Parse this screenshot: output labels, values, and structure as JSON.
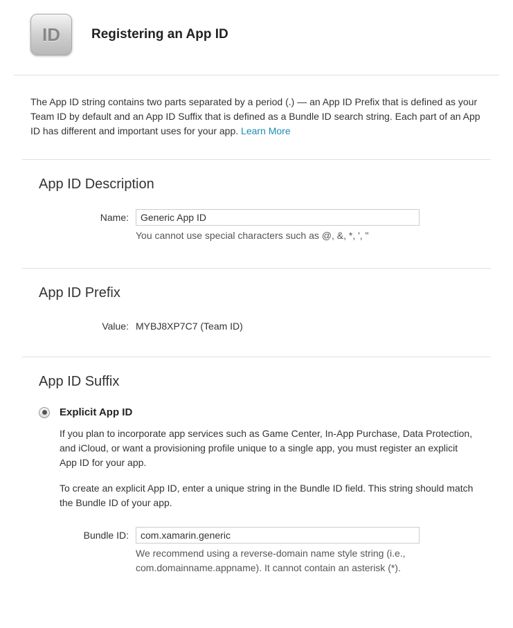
{
  "header": {
    "icon_text": "ID",
    "title": "Registering an App ID"
  },
  "intro": {
    "text": "The App ID string contains two parts separated by a period (.) — an App ID Prefix that is defined as your Team ID by default and an App ID Suffix that is defined as a Bundle ID search string. Each part of an App ID has different and important uses for your app. ",
    "learn_more": "Learn More"
  },
  "description_section": {
    "heading": "App ID Description",
    "name_label": "Name:",
    "name_value": "Generic App ID",
    "name_hint": "You cannot use special characters such as @, &, *, ', \""
  },
  "prefix_section": {
    "heading": "App ID Prefix",
    "value_label": "Value:",
    "value_text": "MYBJ8XP7C7 (Team ID)"
  },
  "suffix_section": {
    "heading": "App ID Suffix",
    "explicit": {
      "label": "Explicit App ID",
      "desc1": "If you plan to incorporate app services such as Game Center, In-App Purchase, Data Protection, and iCloud, or want a provisioning profile unique to a single app, you must register an explicit App ID for your app.",
      "desc2": "To create an explicit App ID, enter a unique string in the Bundle ID field. This string should match the Bundle ID of your app.",
      "bundle_label": "Bundle ID:",
      "bundle_value": "com.xamarin.generic",
      "bundle_hint": "We recommend using a reverse-domain name style string (i.e., com.domainname.appname). It cannot contain an asterisk (*)."
    }
  }
}
